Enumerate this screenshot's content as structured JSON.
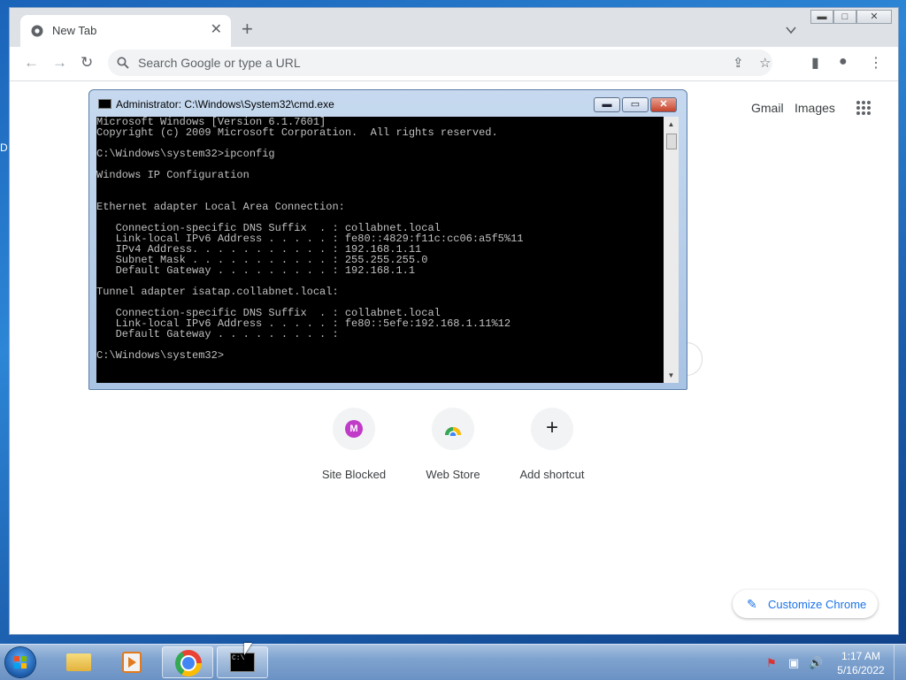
{
  "desktop": {
    "edge_text": "D"
  },
  "browser": {
    "tab": {
      "title": "New Tab",
      "close_glyph": "✕"
    },
    "new_tab_glyph": "+",
    "window_controls": {
      "minimize": "▬",
      "maximize": "□",
      "close": "✕"
    },
    "toolbar": {
      "back": "←",
      "forward": "→",
      "reload": "↻",
      "omnibox_placeholder": "Search Google or type a URL",
      "share_glyph": "⇪",
      "star_glyph": "☆",
      "side_panel_glyph": "▮",
      "profile_glyph": "●",
      "menu_glyph": "⋮"
    },
    "ntp": {
      "gmail": "Gmail",
      "images": "Images",
      "shortcuts": [
        {
          "label": "Site Blocked",
          "avatar_letter": "M"
        },
        {
          "label": "Web Store"
        },
        {
          "label": "Add shortcut",
          "glyph": "+"
        }
      ],
      "customize_label": "Customize Chrome",
      "customize_glyph": "✎"
    }
  },
  "cmd_window": {
    "title": "Administrator: C:\\Windows\\System32\\cmd.exe",
    "buttons": {
      "minimize": "▬",
      "maximize": "▭",
      "close": "✕"
    },
    "lines": [
      "Microsoft Windows [Version 6.1.7601]",
      "Copyright (c) 2009 Microsoft Corporation.  All rights reserved.",
      "",
      "C:\\Windows\\system32>ipconfig",
      "",
      "Windows IP Configuration",
      "",
      "",
      "Ethernet adapter Local Area Connection:",
      "",
      "   Connection-specific DNS Suffix  . : collabnet.local",
      "   Link-local IPv6 Address . . . . . : fe80::4829:f11c:cc06:a5f5%11",
      "   IPv4 Address. . . . . . . . . . . : 192.168.1.11",
      "   Subnet Mask . . . . . . . . . . . : 255.255.255.0",
      "   Default Gateway . . . . . . . . . : 192.168.1.1",
      "",
      "Tunnel adapter isatap.collabnet.local:",
      "",
      "   Connection-specific DNS Suffix  . : collabnet.local",
      "   Link-local IPv6 Address . . . . . : fe80::5efe:192.168.1.11%12",
      "   Default Gateway . . . . . . . . . :",
      "",
      "C:\\Windows\\system32>"
    ],
    "scroll_up": "▲",
    "scroll_down": "▼"
  },
  "taskbar": {
    "cmd_icon_text": "C:\\",
    "clock_time": "1:17 AM",
    "clock_date": "5/16/2022",
    "tray": {
      "flag": "⚑",
      "network": "▣",
      "volume": "🔊"
    }
  }
}
